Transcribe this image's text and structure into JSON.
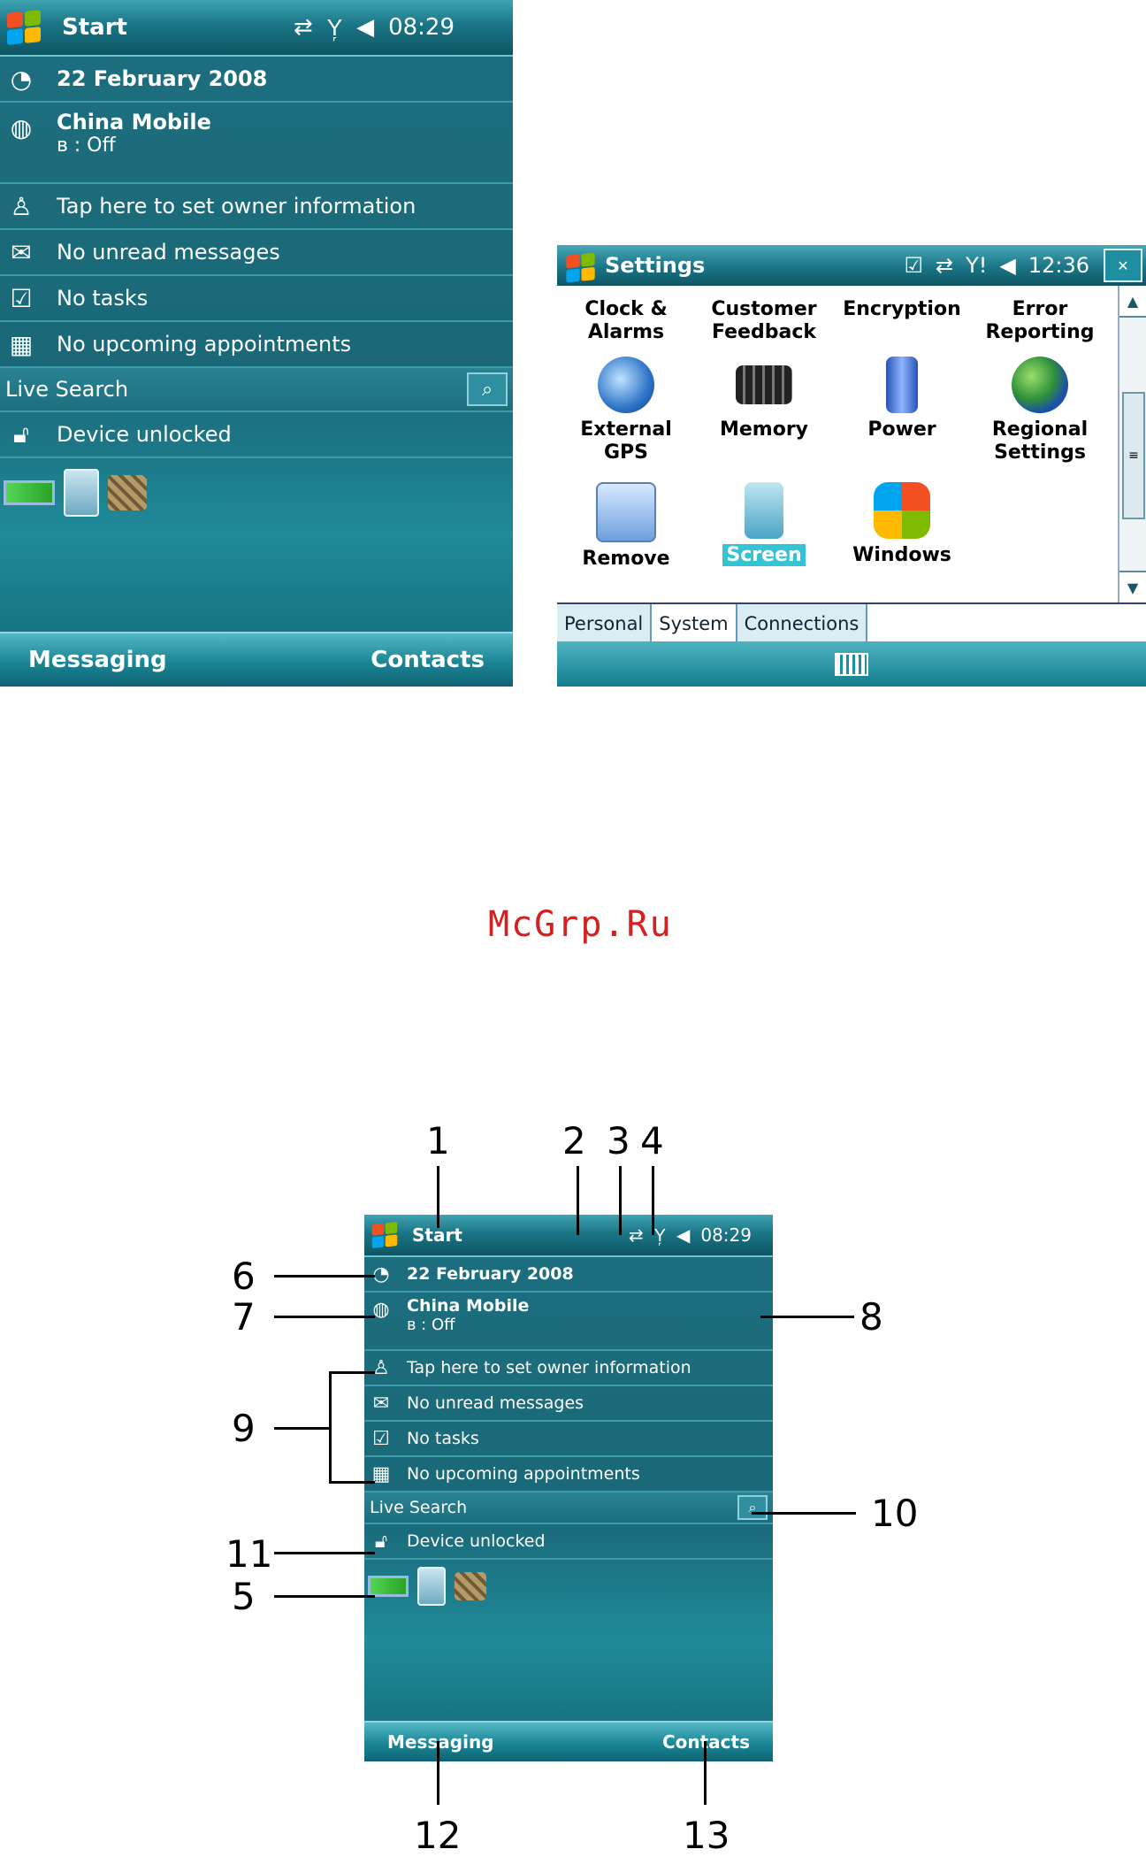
{
  "today": {
    "title": "Start",
    "time": "08:29",
    "date": "22 February 2008",
    "carrier": "China Mobile",
    "bluetooth_status": ": Off",
    "owner": "Tap here to set owner information",
    "messages": "No unread messages",
    "tasks": "No tasks",
    "appointments": "No upcoming appointments",
    "search_label": "Live Search",
    "device": "Device unlocked",
    "softkey_left": "Messaging",
    "softkey_right": "Contacts"
  },
  "settings": {
    "title": "Settings",
    "time": "12:36",
    "close": "✕",
    "items": [
      {
        "label": "Clock &\nAlarms"
      },
      {
        "label": "Customer\nFeedback"
      },
      {
        "label": "Encryption"
      },
      {
        "label": "Error\nReporting"
      },
      {
        "label": "External\nGPS"
      },
      {
        "label": "Memory"
      },
      {
        "label": "Power"
      },
      {
        "label": "Regional\nSettings"
      },
      {
        "label": "Remove"
      },
      {
        "label": "Screen"
      },
      {
        "label": "Windows"
      }
    ],
    "tabs": [
      "Personal",
      "System",
      "Connections"
    ],
    "active_tab": "System"
  },
  "watermark": "McGrp.Ru",
  "figure": {
    "callouts": [
      "1",
      "2",
      "3",
      "4",
      "5",
      "6",
      "7",
      "8",
      "9",
      "10",
      "11",
      "12",
      "13"
    ]
  },
  "colors": {
    "theme_teal": "#1a6878",
    "selection": "#35c4d4",
    "watermark": "#d62020"
  }
}
